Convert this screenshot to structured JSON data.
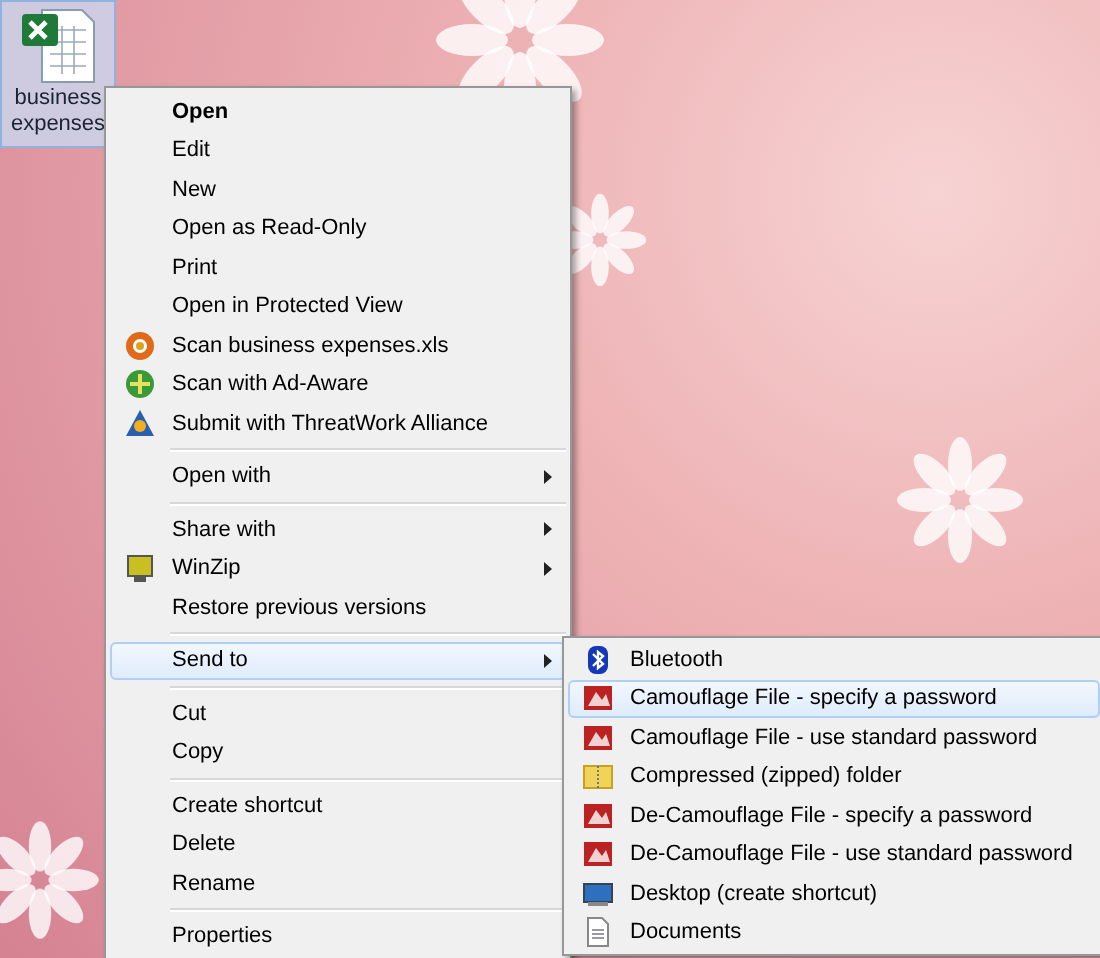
{
  "desktop_icon": {
    "label": "business expenses",
    "selected": true
  },
  "context_menu": {
    "items": [
      {
        "kind": "item",
        "label": "Open",
        "bold": true,
        "submenu": false,
        "selected": false
      },
      {
        "kind": "item",
        "label": "Edit",
        "bold": false,
        "submenu": false,
        "selected": false
      },
      {
        "kind": "item",
        "label": "New",
        "bold": false,
        "submenu": false,
        "selected": false
      },
      {
        "kind": "item",
        "label": "Open as Read-Only",
        "bold": false,
        "submenu": false,
        "selected": false
      },
      {
        "kind": "item",
        "label": "Print",
        "bold": false,
        "submenu": false,
        "selected": false
      },
      {
        "kind": "item",
        "label": "Open in Protected View",
        "bold": false,
        "submenu": false,
        "selected": false
      },
      {
        "kind": "item",
        "label": "Scan business expenses.xls",
        "bold": false,
        "submenu": false,
        "selected": false
      },
      {
        "kind": "item",
        "label": "Scan with Ad-Aware",
        "bold": false,
        "submenu": false,
        "selected": false
      },
      {
        "kind": "item",
        "label": "Submit with ThreatWork Alliance",
        "bold": false,
        "submenu": false,
        "selected": false
      },
      {
        "kind": "separator"
      },
      {
        "kind": "item",
        "label": "Open with",
        "bold": false,
        "submenu": true,
        "selected": false
      },
      {
        "kind": "separator"
      },
      {
        "kind": "item",
        "label": "Share with",
        "bold": false,
        "submenu": true,
        "selected": false
      },
      {
        "kind": "item",
        "label": "WinZip",
        "bold": false,
        "submenu": true,
        "selected": false
      },
      {
        "kind": "item",
        "label": "Restore previous versions",
        "bold": false,
        "submenu": false,
        "selected": false
      },
      {
        "kind": "separator"
      },
      {
        "kind": "item",
        "label": "Send to",
        "bold": false,
        "submenu": true,
        "selected": true
      },
      {
        "kind": "separator"
      },
      {
        "kind": "item",
        "label": "Cut",
        "bold": false,
        "submenu": false,
        "selected": false
      },
      {
        "kind": "item",
        "label": "Copy",
        "bold": false,
        "submenu": false,
        "selected": false
      },
      {
        "kind": "separator"
      },
      {
        "kind": "item",
        "label": "Create shortcut",
        "bold": false,
        "submenu": false,
        "selected": false
      },
      {
        "kind": "item",
        "label": "Delete",
        "bold": false,
        "submenu": false,
        "selected": false
      },
      {
        "kind": "item",
        "label": "Rename",
        "bold": false,
        "submenu": false,
        "selected": false
      },
      {
        "kind": "separator"
      },
      {
        "kind": "item",
        "label": "Properties",
        "bold": false,
        "submenu": false,
        "selected": false
      }
    ]
  },
  "send_to_menu": {
    "items": [
      {
        "label": "Bluetooth",
        "selected": false
      },
      {
        "label": "Camouflage File - specify a password",
        "selected": true
      },
      {
        "label": "Camouflage File - use standard password",
        "selected": false
      },
      {
        "label": "Compressed (zipped) folder",
        "selected": false
      },
      {
        "label": "De-Camouflage File - specify a password",
        "selected": false
      },
      {
        "label": "De-Camouflage File - use standard password",
        "selected": false
      },
      {
        "label": "Desktop (create shortcut)",
        "selected": false
      },
      {
        "label": "Documents",
        "selected": false
      }
    ]
  }
}
